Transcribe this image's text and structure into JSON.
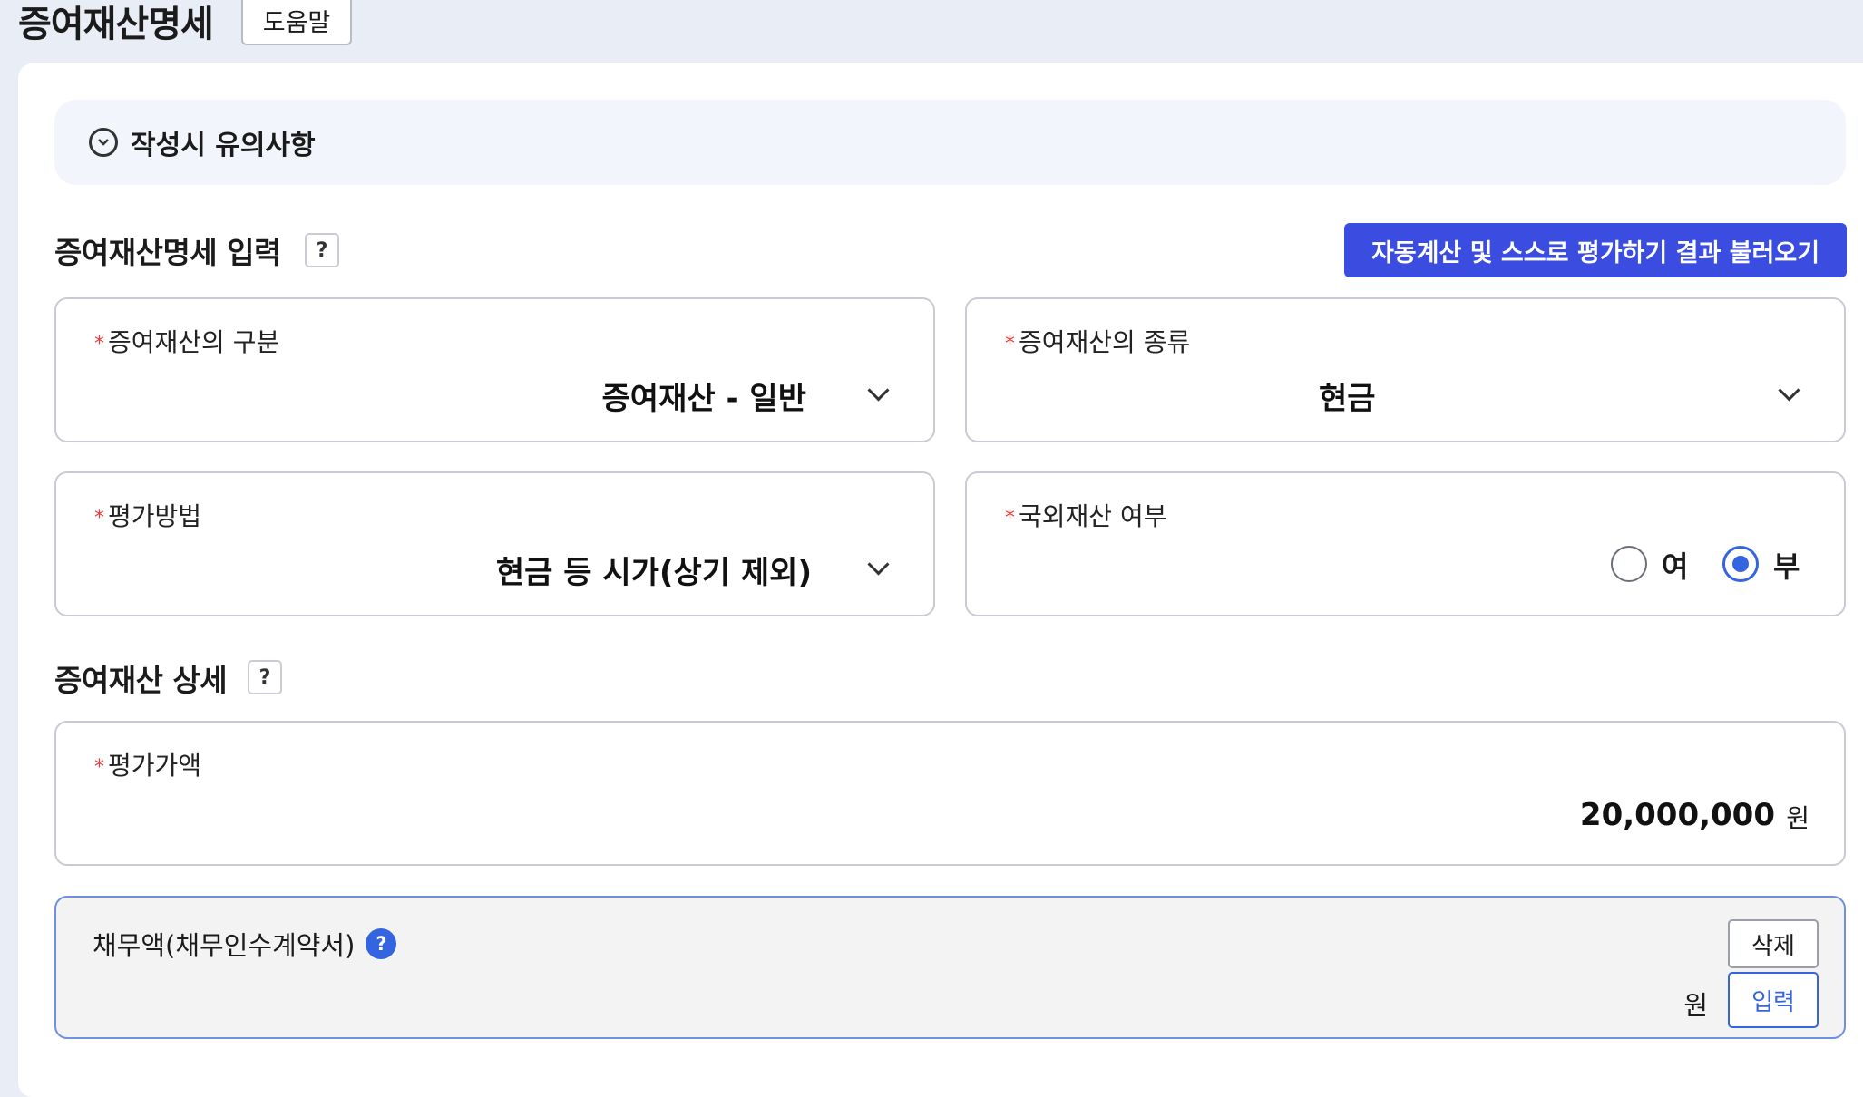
{
  "header": {
    "title": "증여재산명세",
    "help_label": "도움말"
  },
  "notice": {
    "label": "작성시 유의사항",
    "icon": "chevron-circle-icon"
  },
  "input_section": {
    "title": "증여재산명세 입력",
    "help_badge": "?",
    "load_button": "자동계산 및 스스로 평가하기 결과 불러오기",
    "fields": {
      "category": {
        "label": "증여재산의 구분",
        "value": "증여재산 - 일반"
      },
      "kind": {
        "label": "증여재산의 종류",
        "value": "현금"
      },
      "method": {
        "label": "평가방법",
        "value": "현금 등 시가(상기 제외)"
      },
      "foreign": {
        "label": "국외재산 여부",
        "options": [
          "여",
          "부"
        ],
        "selected": "부"
      }
    }
  },
  "detail_section": {
    "title": "증여재산 상세",
    "help_badge": "?",
    "amount": {
      "label": "평가가액",
      "value": "20,000,000",
      "unit": "원"
    },
    "debt": {
      "label": "채무액(채무인수계약서)",
      "help_badge": "?",
      "delete_label": "삭제",
      "unit": "원",
      "input_label": "입력"
    }
  },
  "required_mark": "*",
  "colors": {
    "accent": "#3b4de0",
    "required": "#e23d3d",
    "radio_checked": "#3464e0"
  }
}
